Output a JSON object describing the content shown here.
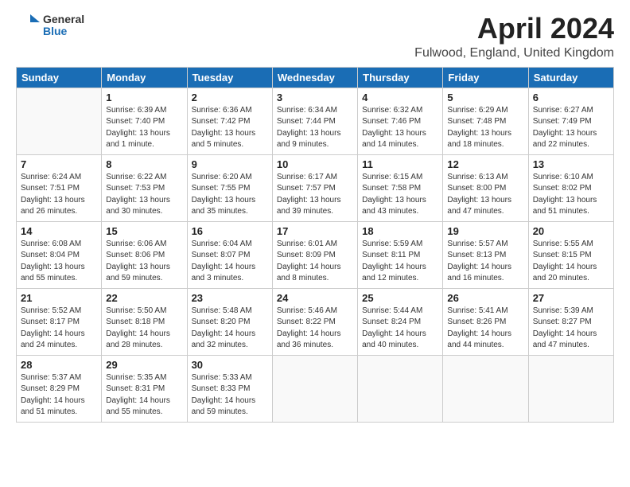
{
  "header": {
    "logo_line1": "General",
    "logo_line2": "Blue",
    "month_title": "April 2024",
    "location": "Fulwood, England, United Kingdom"
  },
  "weekdays": [
    "Sunday",
    "Monday",
    "Tuesday",
    "Wednesday",
    "Thursday",
    "Friday",
    "Saturday"
  ],
  "weeks": [
    [
      {
        "day": "",
        "info": ""
      },
      {
        "day": "1",
        "info": "Sunrise: 6:39 AM\nSunset: 7:40 PM\nDaylight: 13 hours\nand 1 minute."
      },
      {
        "day": "2",
        "info": "Sunrise: 6:36 AM\nSunset: 7:42 PM\nDaylight: 13 hours\nand 5 minutes."
      },
      {
        "day": "3",
        "info": "Sunrise: 6:34 AM\nSunset: 7:44 PM\nDaylight: 13 hours\nand 9 minutes."
      },
      {
        "day": "4",
        "info": "Sunrise: 6:32 AM\nSunset: 7:46 PM\nDaylight: 13 hours\nand 14 minutes."
      },
      {
        "day": "5",
        "info": "Sunrise: 6:29 AM\nSunset: 7:48 PM\nDaylight: 13 hours\nand 18 minutes."
      },
      {
        "day": "6",
        "info": "Sunrise: 6:27 AM\nSunset: 7:49 PM\nDaylight: 13 hours\nand 22 minutes."
      }
    ],
    [
      {
        "day": "7",
        "info": "Sunrise: 6:24 AM\nSunset: 7:51 PM\nDaylight: 13 hours\nand 26 minutes."
      },
      {
        "day": "8",
        "info": "Sunrise: 6:22 AM\nSunset: 7:53 PM\nDaylight: 13 hours\nand 30 minutes."
      },
      {
        "day": "9",
        "info": "Sunrise: 6:20 AM\nSunset: 7:55 PM\nDaylight: 13 hours\nand 35 minutes."
      },
      {
        "day": "10",
        "info": "Sunrise: 6:17 AM\nSunset: 7:57 PM\nDaylight: 13 hours\nand 39 minutes."
      },
      {
        "day": "11",
        "info": "Sunrise: 6:15 AM\nSunset: 7:58 PM\nDaylight: 13 hours\nand 43 minutes."
      },
      {
        "day": "12",
        "info": "Sunrise: 6:13 AM\nSunset: 8:00 PM\nDaylight: 13 hours\nand 47 minutes."
      },
      {
        "day": "13",
        "info": "Sunrise: 6:10 AM\nSunset: 8:02 PM\nDaylight: 13 hours\nand 51 minutes."
      }
    ],
    [
      {
        "day": "14",
        "info": "Sunrise: 6:08 AM\nSunset: 8:04 PM\nDaylight: 13 hours\nand 55 minutes."
      },
      {
        "day": "15",
        "info": "Sunrise: 6:06 AM\nSunset: 8:06 PM\nDaylight: 13 hours\nand 59 minutes."
      },
      {
        "day": "16",
        "info": "Sunrise: 6:04 AM\nSunset: 8:07 PM\nDaylight: 14 hours\nand 3 minutes."
      },
      {
        "day": "17",
        "info": "Sunrise: 6:01 AM\nSunset: 8:09 PM\nDaylight: 14 hours\nand 8 minutes."
      },
      {
        "day": "18",
        "info": "Sunrise: 5:59 AM\nSunset: 8:11 PM\nDaylight: 14 hours\nand 12 minutes."
      },
      {
        "day": "19",
        "info": "Sunrise: 5:57 AM\nSunset: 8:13 PM\nDaylight: 14 hours\nand 16 minutes."
      },
      {
        "day": "20",
        "info": "Sunrise: 5:55 AM\nSunset: 8:15 PM\nDaylight: 14 hours\nand 20 minutes."
      }
    ],
    [
      {
        "day": "21",
        "info": "Sunrise: 5:52 AM\nSunset: 8:17 PM\nDaylight: 14 hours\nand 24 minutes."
      },
      {
        "day": "22",
        "info": "Sunrise: 5:50 AM\nSunset: 8:18 PM\nDaylight: 14 hours\nand 28 minutes."
      },
      {
        "day": "23",
        "info": "Sunrise: 5:48 AM\nSunset: 8:20 PM\nDaylight: 14 hours\nand 32 minutes."
      },
      {
        "day": "24",
        "info": "Sunrise: 5:46 AM\nSunset: 8:22 PM\nDaylight: 14 hours\nand 36 minutes."
      },
      {
        "day": "25",
        "info": "Sunrise: 5:44 AM\nSunset: 8:24 PM\nDaylight: 14 hours\nand 40 minutes."
      },
      {
        "day": "26",
        "info": "Sunrise: 5:41 AM\nSunset: 8:26 PM\nDaylight: 14 hours\nand 44 minutes."
      },
      {
        "day": "27",
        "info": "Sunrise: 5:39 AM\nSunset: 8:27 PM\nDaylight: 14 hours\nand 47 minutes."
      }
    ],
    [
      {
        "day": "28",
        "info": "Sunrise: 5:37 AM\nSunset: 8:29 PM\nDaylight: 14 hours\nand 51 minutes."
      },
      {
        "day": "29",
        "info": "Sunrise: 5:35 AM\nSunset: 8:31 PM\nDaylight: 14 hours\nand 55 minutes."
      },
      {
        "day": "30",
        "info": "Sunrise: 5:33 AM\nSunset: 8:33 PM\nDaylight: 14 hours\nand 59 minutes."
      },
      {
        "day": "",
        "info": ""
      },
      {
        "day": "",
        "info": ""
      },
      {
        "day": "",
        "info": ""
      },
      {
        "day": "",
        "info": ""
      }
    ]
  ]
}
